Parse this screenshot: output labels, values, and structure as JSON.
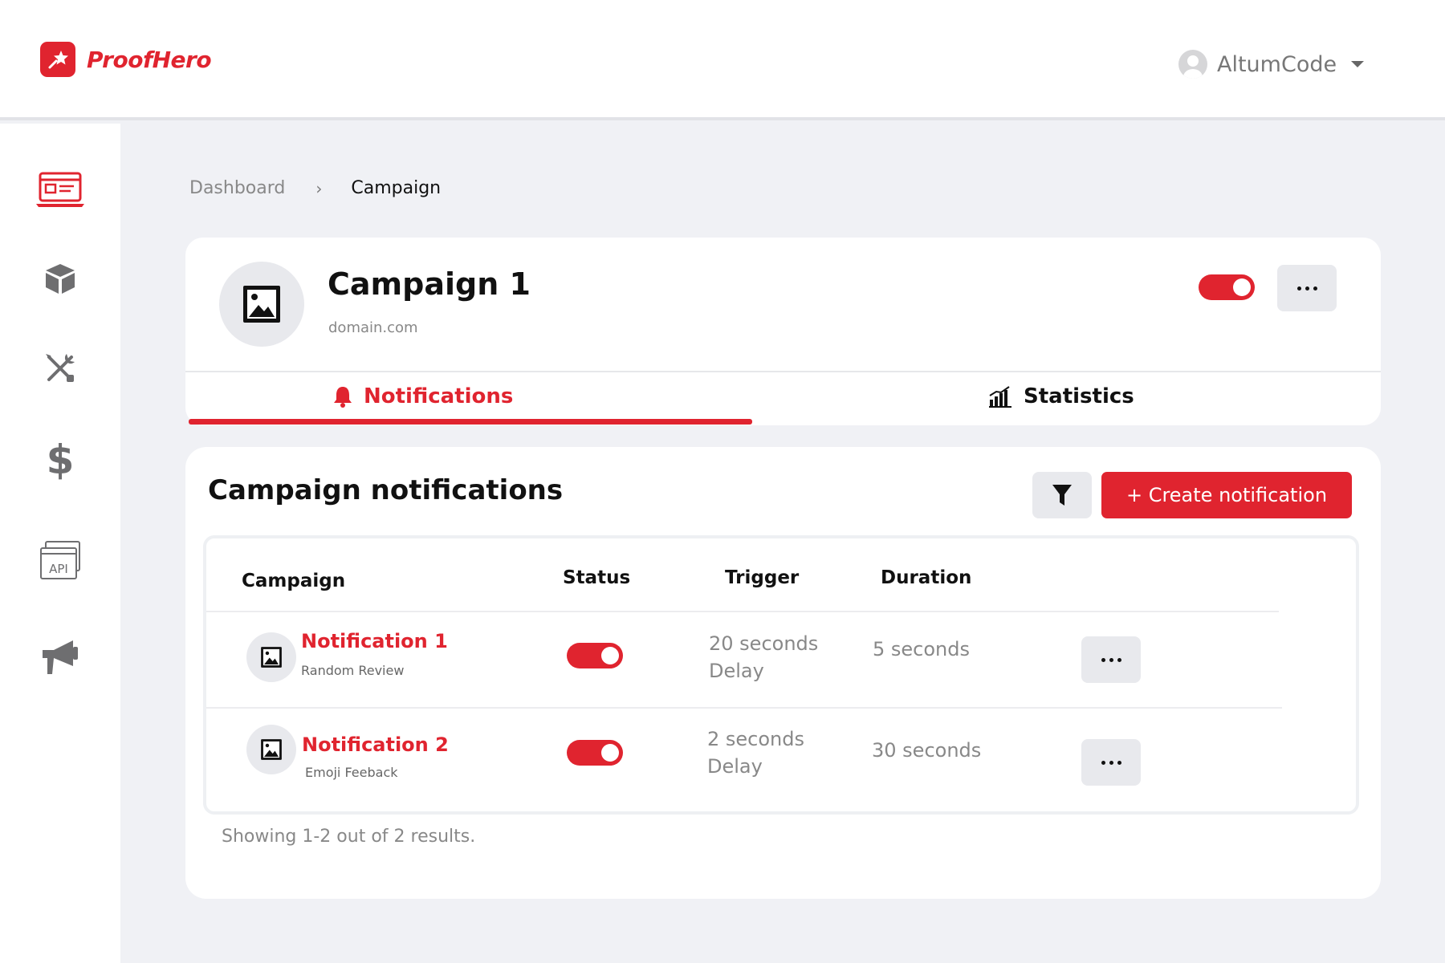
{
  "brand": {
    "name": "ProofHero",
    "accent": "#e0242f"
  },
  "user": {
    "name": "AltumCode"
  },
  "sidebar": {
    "items": [
      {
        "icon": "website-icon",
        "active": true
      },
      {
        "icon": "box-icon",
        "active": false
      },
      {
        "icon": "tools-icon",
        "active": false
      },
      {
        "icon": "dollar-icon",
        "active": false
      },
      {
        "icon": "api-icon",
        "active": false
      },
      {
        "icon": "megaphone-icon",
        "active": false
      }
    ]
  },
  "breadcrumb": {
    "parent": "Dashboard",
    "separator": "›",
    "current": "Campaign"
  },
  "campaign": {
    "title": "Campaign 1",
    "domain": "domain.com",
    "enabled": true,
    "tabs": [
      {
        "label": "Notifications",
        "icon": "bell-icon",
        "active": true
      },
      {
        "label": "Statistics",
        "icon": "bar-chart-icon",
        "active": false
      }
    ]
  },
  "notifications": {
    "title": "Campaign notifications",
    "create_label": "+ Create notification",
    "columns": {
      "campaign": "Campaign",
      "status": "Status",
      "trigger": "Trigger",
      "duration": "Duration"
    },
    "rows": [
      {
        "name": "Notification 1",
        "type": "Random Review",
        "enabled": true,
        "trigger_1": "20 seconds",
        "trigger_2": "Delay",
        "duration": "5 seconds"
      },
      {
        "name": "Notification 2",
        "type": "Emoji Feeback",
        "enabled": true,
        "trigger_1": "2 seconds",
        "trigger_2": "Delay",
        "duration": "30 seconds"
      }
    ],
    "showing": "Showing 1-2 out of 2 results."
  }
}
